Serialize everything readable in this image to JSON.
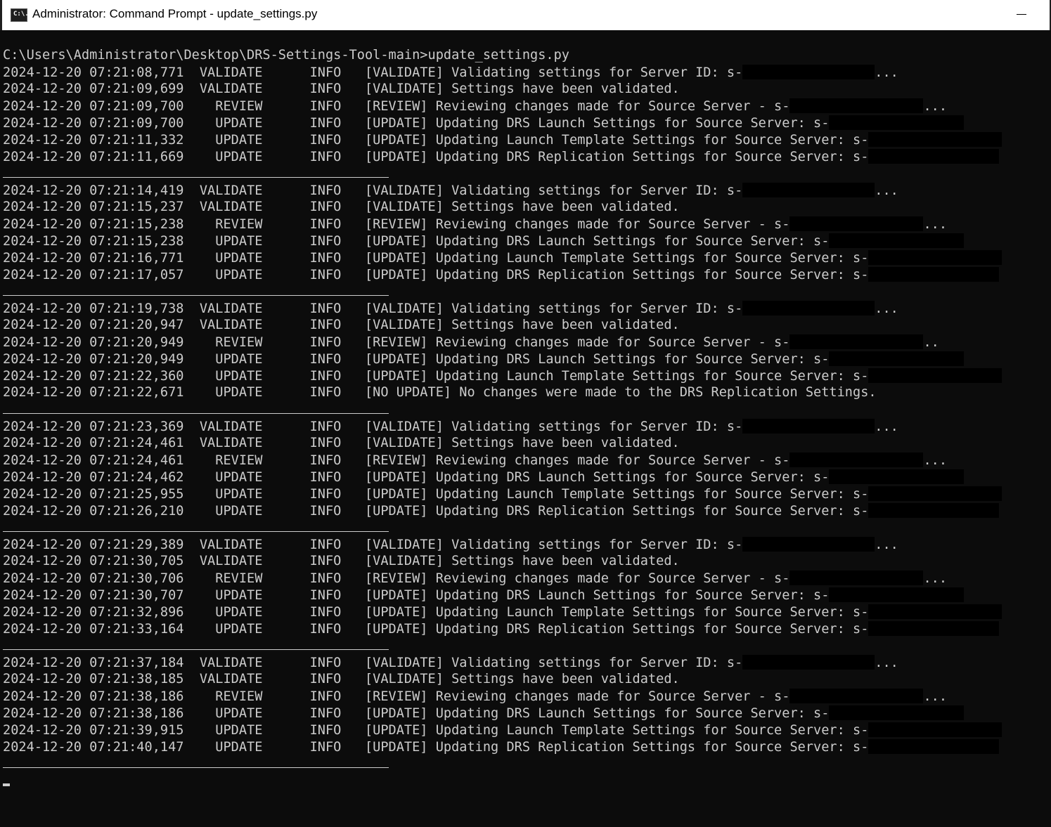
{
  "window": {
    "title": "Administrator: Command Prompt - update_settings.py",
    "icon_label": "C:\\."
  },
  "console": {
    "prompt": "C:\\Users\\Administrator\\Desktop\\DRS-Settings-Tool-main>update_settings.py",
    "blocks": [
      {
        "lines": [
          {
            "ts": "2024-12-20 07:21:08,771",
            "stage": "VALIDATE",
            "level": "INFO",
            "msg": "[VALIDATE] Validating settings for Server ID: s-",
            "suffix": "..."
          },
          {
            "ts": "2024-12-20 07:21:09,699",
            "stage": "VALIDATE",
            "level": "INFO",
            "msg": "[VALIDATE] Settings have been validated.",
            "suffix": ""
          },
          {
            "ts": "2024-12-20 07:21:09,700",
            "stage": "REVIEW",
            "level": "INFO",
            "msg": "[REVIEW] Reviewing changes made for Source Server - s-",
            "suffix": "..."
          },
          {
            "ts": "2024-12-20 07:21:09,700",
            "stage": "UPDATE",
            "level": "INFO",
            "msg": "[UPDATE] Updating DRS Launch Settings for Source Server: s-",
            "suffix": ""
          },
          {
            "ts": "2024-12-20 07:21:11,332",
            "stage": "UPDATE",
            "level": "INFO",
            "msg": "[UPDATE] Updating Launch Template Settings for Source Server: s-",
            "suffix": ""
          },
          {
            "ts": "2024-12-20 07:21:11,669",
            "stage": "UPDATE",
            "level": "INFO",
            "msg": "[UPDATE] Updating DRS Replication Settings for Source Server: s-",
            "suffix": ""
          }
        ]
      },
      {
        "lines": [
          {
            "ts": "2024-12-20 07:21:14,419",
            "stage": "VALIDATE",
            "level": "INFO",
            "msg": "[VALIDATE] Validating settings for Server ID: s-",
            "suffix": "..."
          },
          {
            "ts": "2024-12-20 07:21:15,237",
            "stage": "VALIDATE",
            "level": "INFO",
            "msg": "[VALIDATE] Settings have been validated.",
            "suffix": ""
          },
          {
            "ts": "2024-12-20 07:21:15,238",
            "stage": "REVIEW",
            "level": "INFO",
            "msg": "[REVIEW] Reviewing changes made for Source Server - s-",
            "suffix": "..."
          },
          {
            "ts": "2024-12-20 07:21:15,238",
            "stage": "UPDATE",
            "level": "INFO",
            "msg": "[UPDATE] Updating DRS Launch Settings for Source Server: s-",
            "suffix": ""
          },
          {
            "ts": "2024-12-20 07:21:16,771",
            "stage": "UPDATE",
            "level": "INFO",
            "msg": "[UPDATE] Updating Launch Template Settings for Source Server: s-",
            "suffix": ""
          },
          {
            "ts": "2024-12-20 07:21:17,057",
            "stage": "UPDATE",
            "level": "INFO",
            "msg": "[UPDATE] Updating DRS Replication Settings for Source Server: s-",
            "suffix": ""
          }
        ]
      },
      {
        "lines": [
          {
            "ts": "2024-12-20 07:21:19,738",
            "stage": "VALIDATE",
            "level": "INFO",
            "msg": "[VALIDATE] Validating settings for Server ID: s-",
            "suffix": "..."
          },
          {
            "ts": "2024-12-20 07:21:20,947",
            "stage": "VALIDATE",
            "level": "INFO",
            "msg": "[VALIDATE] Settings have been validated.",
            "suffix": ""
          },
          {
            "ts": "2024-12-20 07:21:20,949",
            "stage": "REVIEW",
            "level": "INFO",
            "msg": "[REVIEW] Reviewing changes made for Source Server - s-",
            "suffix": ".."
          },
          {
            "ts": "2024-12-20 07:21:20,949",
            "stage": "UPDATE",
            "level": "INFO",
            "msg": "[UPDATE] Updating DRS Launch Settings for Source Server: s-",
            "suffix": ""
          },
          {
            "ts": "2024-12-20 07:21:22,360",
            "stage": "UPDATE",
            "level": "INFO",
            "msg": "[UPDATE] Updating Launch Template Settings for Source Server: s-",
            "suffix": ""
          },
          {
            "ts": "2024-12-20 07:21:22,671",
            "stage": "UPDATE",
            "level": "INFO",
            "msg": "[NO UPDATE] No changes were made to the DRS Replication Settings.",
            "suffix": "",
            "noredact": true
          }
        ]
      },
      {
        "lines": [
          {
            "ts": "2024-12-20 07:21:23,369",
            "stage": "VALIDATE",
            "level": "INFO",
            "msg": "[VALIDATE] Validating settings for Server ID: s-",
            "suffix": "..."
          },
          {
            "ts": "2024-12-20 07:21:24,461",
            "stage": "VALIDATE",
            "level": "INFO",
            "msg": "[VALIDATE] Settings have been validated.",
            "suffix": ""
          },
          {
            "ts": "2024-12-20 07:21:24,461",
            "stage": "REVIEW",
            "level": "INFO",
            "msg": "[REVIEW] Reviewing changes made for Source Server - s-",
            "suffix": "..."
          },
          {
            "ts": "2024-12-20 07:21:24,462",
            "stage": "UPDATE",
            "level": "INFO",
            "msg": "[UPDATE] Updating DRS Launch Settings for Source Server: s-",
            "suffix": ""
          },
          {
            "ts": "2024-12-20 07:21:25,955",
            "stage": "UPDATE",
            "level": "INFO",
            "msg": "[UPDATE] Updating Launch Template Settings for Source Server: s-",
            "suffix": ""
          },
          {
            "ts": "2024-12-20 07:21:26,210",
            "stage": "UPDATE",
            "level": "INFO",
            "msg": "[UPDATE] Updating DRS Replication Settings for Source Server: s-",
            "suffix": ""
          }
        ]
      },
      {
        "lines": [
          {
            "ts": "2024-12-20 07:21:29,389",
            "stage": "VALIDATE",
            "level": "INFO",
            "msg": "[VALIDATE] Validating settings for Server ID: s-",
            "suffix": "..."
          },
          {
            "ts": "2024-12-20 07:21:30,705",
            "stage": "VALIDATE",
            "level": "INFO",
            "msg": "[VALIDATE] Settings have been validated.",
            "suffix": ""
          },
          {
            "ts": "2024-12-20 07:21:30,706",
            "stage": "REVIEW",
            "level": "INFO",
            "msg": "[REVIEW] Reviewing changes made for Source Server - s-",
            "suffix": "..."
          },
          {
            "ts": "2024-12-20 07:21:30,707",
            "stage": "UPDATE",
            "level": "INFO",
            "msg": "[UPDATE] Updating DRS Launch Settings for Source Server: s-",
            "suffix": ""
          },
          {
            "ts": "2024-12-20 07:21:32,896",
            "stage": "UPDATE",
            "level": "INFO",
            "msg": "[UPDATE] Updating Launch Template Settings for Source Server: s-",
            "suffix": ""
          },
          {
            "ts": "2024-12-20 07:21:33,164",
            "stage": "UPDATE",
            "level": "INFO",
            "msg": "[UPDATE] Updating DRS Replication Settings for Source Server: s-",
            "suffix": ""
          }
        ]
      },
      {
        "lines": [
          {
            "ts": "2024-12-20 07:21:37,184",
            "stage": "VALIDATE",
            "level": "INFO",
            "msg": "[VALIDATE] Validating settings for Server ID: s-",
            "suffix": "..."
          },
          {
            "ts": "2024-12-20 07:21:38,185",
            "stage": "VALIDATE",
            "level": "INFO",
            "msg": "[VALIDATE] Settings have been validated.",
            "suffix": ""
          },
          {
            "ts": "2024-12-20 07:21:38,186",
            "stage": "REVIEW",
            "level": "INFO",
            "msg": "[REVIEW] Reviewing changes made for Source Server - s-",
            "suffix": "..."
          },
          {
            "ts": "2024-12-20 07:21:38,186",
            "stage": "UPDATE",
            "level": "INFO",
            "msg": "[UPDATE] Updating DRS Launch Settings for Source Server: s-",
            "suffix": ""
          },
          {
            "ts": "2024-12-20 07:21:39,915",
            "stage": "UPDATE",
            "level": "INFO",
            "msg": "[UPDATE] Updating Launch Template Settings for Source Server: s-",
            "suffix": ""
          },
          {
            "ts": "2024-12-20 07:21:40,147",
            "stage": "UPDATE",
            "level": "INFO",
            "msg": "[UPDATE] Updating DRS Replication Settings for Source Server: s-",
            "suffix": ""
          }
        ]
      }
    ]
  }
}
